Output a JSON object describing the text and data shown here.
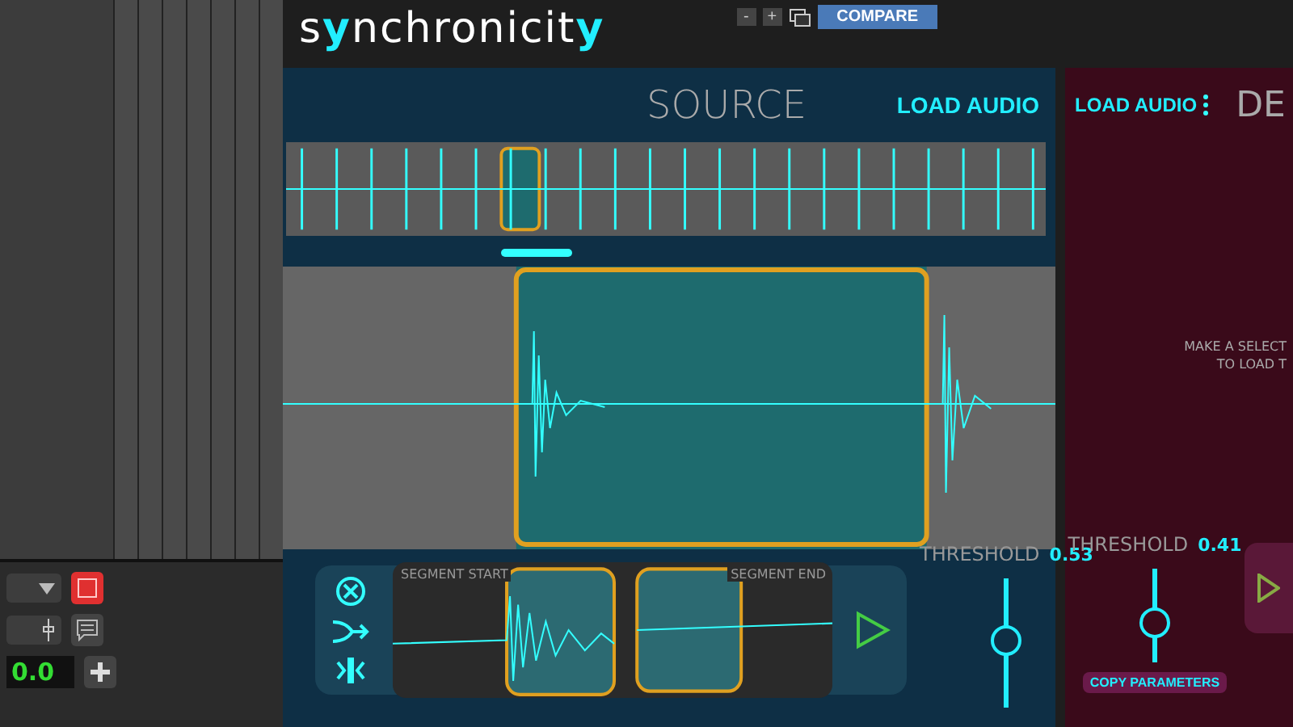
{
  "header": {
    "logo": [
      {
        "text": "s",
        "accent": false
      },
      {
        "text": "y",
        "accent": true
      },
      {
        "text": "nchronicit",
        "accent": false
      },
      {
        "text": "y",
        "accent": true
      }
    ],
    "minus": "-",
    "plus": "+",
    "compare": "COMPARE"
  },
  "daw": {
    "value": "0.0"
  },
  "source": {
    "title": "SOURCE",
    "load": "LOAD AUDIO",
    "segment_start": "SEGMENT START",
    "segment_end": "SEGMENT END",
    "threshold_label": "THRESHOLD",
    "threshold_value": "0.53",
    "threshold": {
      "level": 0.51
    }
  },
  "destination": {
    "load": "LOAD AUDIO",
    "title": "DE",
    "message": [
      "MAKE A SELECT",
      "TO LOAD T"
    ],
    "threshold_label": "THRESHOLD",
    "threshold_value": "0.41",
    "threshold": {
      "level": 0.41
    },
    "copy": "COPY PARAMETERS"
  }
}
